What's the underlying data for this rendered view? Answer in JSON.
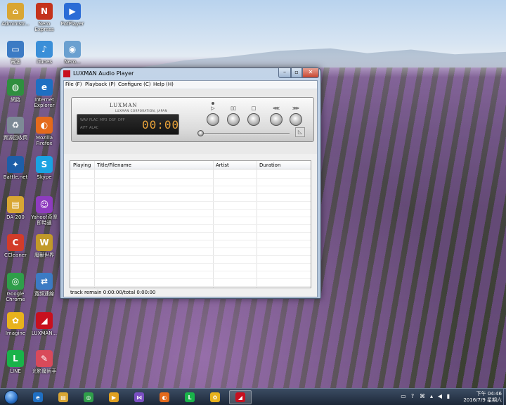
{
  "desktop": {
    "icons": [
      {
        "label": "Administr...",
        "glyph": "⌂",
        "color": "#d9a633"
      },
      {
        "label": "Nero Express",
        "glyph": "N",
        "color": "#c4331c"
      },
      {
        "label": "PotPlayer",
        "glyph": "▶",
        "color": "#2b6cd6"
      },
      {
        "label": "電腦",
        "glyph": "▭",
        "color": "#3c7bc4"
      },
      {
        "label": "iTunes",
        "glyph": "♪",
        "color": "#3a8fd8"
      },
      {
        "label": "Nero...",
        "glyph": "◉",
        "color": "#6aa0d0"
      },
      {
        "label": "網路",
        "glyph": "◍",
        "color": "#2f8f3f"
      },
      {
        "label": "Internet Explorer",
        "glyph": "e",
        "color": "#1f6fc2"
      },
      {
        "label": "資源回收筒",
        "glyph": "♻",
        "color": "#7d8a96"
      },
      {
        "label": "Mozilla Firefox",
        "glyph": "◐",
        "color": "#e46a1c"
      },
      {
        "label": "Battle.net",
        "glyph": "✦",
        "color": "#1d5ea8"
      },
      {
        "label": "Skype",
        "glyph": "S",
        "color": "#1aa2e2"
      },
      {
        "label": "DA-200",
        "glyph": "▤",
        "color": "#d9a633"
      },
      {
        "label": "Yahoo!奇摩 即時通",
        "glyph": "☺",
        "color": "#8e3cbf"
      },
      {
        "label": "CCleaner",
        "glyph": "C",
        "color": "#d23c2a"
      },
      {
        "label": "魔獸世界",
        "glyph": "W",
        "color": "#c29a2a"
      },
      {
        "label": "Google Chrome",
        "glyph": "◎",
        "color": "#2f9e4a"
      },
      {
        "label": "寬頻連線",
        "glyph": "⇄",
        "color": "#3c7bc4"
      },
      {
        "label": "Imagine",
        "glyph": "✿",
        "color": "#e8b21c"
      },
      {
        "label": "LUXMAN...",
        "glyph": "◢",
        "color": "#c8101e"
      },
      {
        "label": "LINE",
        "glyph": "L",
        "color": "#19b34a"
      },
      {
        "label": "光影魔術手",
        "glyph": "✎",
        "color": "#d94a5a"
      }
    ]
  },
  "window": {
    "title": "LUXMAN Audio Player",
    "controls": {
      "minimize": "–",
      "maximize": "▫",
      "close": "✕"
    },
    "menu": [
      "File (F)",
      "Playback (P)",
      "Configure (C)",
      "Help (H)"
    ],
    "logo": "LUXMAN",
    "logo_sub": "LUXMAN CORPORATION, JAPAN",
    "lcd": {
      "formats_row1": [
        "WAV",
        "FLAC",
        "MP3",
        "DSF",
        "DFF"
      ],
      "formats_row2": [
        "AIFF",
        "ALAC"
      ],
      "time": "00:00"
    },
    "buttons": [
      {
        "name": "play",
        "symbol": "▷"
      },
      {
        "name": "pause",
        "symbol": "▯▯"
      },
      {
        "name": "stop",
        "symbol": "□"
      },
      {
        "name": "previous",
        "symbol": "⋘"
      },
      {
        "name": "next",
        "symbol": "⋙"
      }
    ],
    "eject_symbol": "◺",
    "seek_position": 0,
    "playlist": {
      "columns": [
        "Playing",
        "Title/Filename",
        "Artist",
        "Duration"
      ]
    },
    "status": "track remain 0:00:00/total 0:00:00"
  },
  "taskbar": {
    "apps": [
      {
        "name": "internet-explorer",
        "glyph": "e",
        "color": "#1f6fc2",
        "active": false
      },
      {
        "name": "file-explorer",
        "glyph": "▤",
        "color": "#d9a633",
        "active": false
      },
      {
        "name": "google-chrome",
        "glyph": "◎",
        "color": "#2f9e4a",
        "active": false
      },
      {
        "name": "potplayer",
        "glyph": "▶",
        "color": "#e0a020",
        "active": false
      },
      {
        "name": "visual-studio",
        "glyph": "⋈",
        "color": "#7a4fc2",
        "active": false
      },
      {
        "name": "firefox",
        "glyph": "◐",
        "color": "#e46a1c",
        "active": false
      },
      {
        "name": "line",
        "glyph": "L",
        "color": "#19b34a",
        "active": false
      },
      {
        "name": "imagine",
        "glyph": "✿",
        "color": "#e8b21c",
        "active": false
      },
      {
        "name": "luxman",
        "glyph": "◢",
        "color": "#c8101e",
        "active": true
      }
    ],
    "clock_time": "下午 04:46",
    "clock_date": "2016/7/9 星期六"
  }
}
